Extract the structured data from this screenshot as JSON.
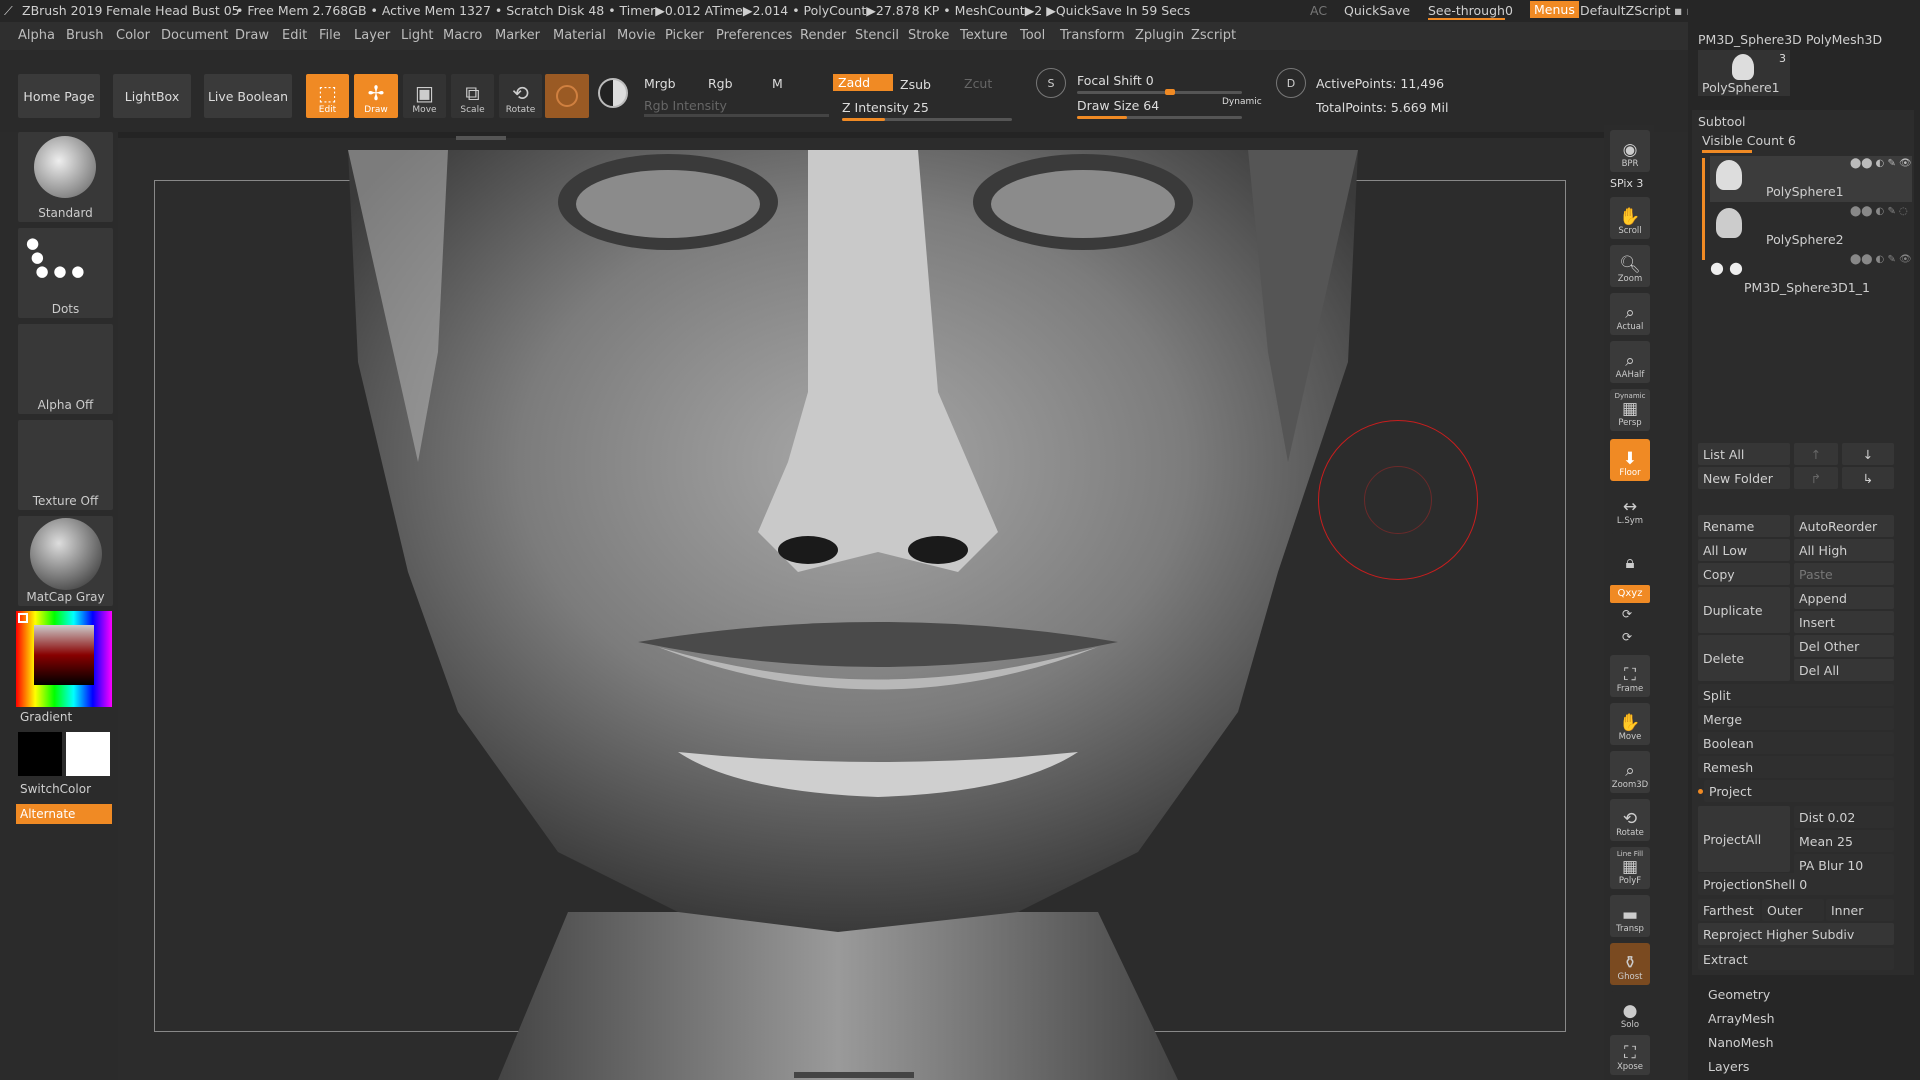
{
  "titlebar": {
    "app": "ZBrush 2019",
    "project": "Female Head Bust 05",
    "stats": "• Free Mem 2.768GB • Active Mem 1327 • Scratch Disk 48 • Timer▶0.012 ATime▶2.014 • PolyCount▶27.878 KP • MeshCount▶2 ▶QuickSave In 59 Secs",
    "ac": "AC",
    "quicksave": "QuickSave",
    "see_through": "See-through",
    "see_through_value": "0",
    "menus": "Menus",
    "zscript": "DefaultZScript"
  },
  "menus": [
    "Alpha",
    "Brush",
    "Color",
    "Document",
    "Draw",
    "Edit",
    "File",
    "Layer",
    "Light",
    "Macro",
    "Marker",
    "Material",
    "Movie",
    "Picker",
    "Preferences",
    "Render",
    "Stencil",
    "Stroke",
    "Texture",
    "Tool",
    "Transform",
    "Zplugin",
    "Zscript"
  ],
  "toolbar": {
    "home_page": "Home Page",
    "lightbox": "LightBox",
    "live_boolean": "Live Boolean",
    "edit": "Edit",
    "draw": "Draw",
    "move": "Move",
    "scale": "Scale",
    "rotate": "Rotate",
    "mrgb": "Mrgb",
    "rgb": "Rgb",
    "m": "M",
    "zadd": "Zadd",
    "zsub": "Zsub",
    "zcut": "Zcut",
    "rgb_intensity": "Rgb Intensity",
    "z_intensity_label": "Z Intensity",
    "z_intensity": "25",
    "z_intensity_fraction": 0.25,
    "focal_shift_label": "Focal Shift",
    "focal_shift": "0",
    "draw_size_label": "Draw Size",
    "draw_size": "64",
    "dynamic": "Dynamic",
    "active_points": "ActivePoints: 11,496",
    "total_points": "TotalPoints: 5.669 Mil",
    "s_label": "S",
    "d_label": "D"
  },
  "left": {
    "standard": "Standard",
    "dots": "Dots",
    "alpha_off": "Alpha Off",
    "texture_off": "Texture Off",
    "matcap": "MatCap Gray",
    "gradient": "Gradient",
    "switchcolor": "SwitchColor",
    "alternate": "Alternate"
  },
  "shelf": [
    "BPR",
    "SPix 3",
    "Scroll",
    "Zoom",
    "Actual",
    "AAHalf",
    "Persp",
    "Floor",
    "L.Sym",
    "",
    "Qxyz",
    "Frame",
    "Move",
    "Zoom3D",
    "Rotate",
    "PolyF",
    "Transp",
    "Ghost",
    "Solo",
    "Xpose"
  ],
  "shelf_extra": {
    "dynamic": "Dynamic",
    "line_fill": "Line Fill"
  },
  "tray": {
    "top_tool_1": "PM3D_Sphere3D",
    "top_tool_2": "PolyMesh3D",
    "top_tool_3": "PolySphere1",
    "top_tool_count": "3",
    "subtool": "Subtool",
    "visible_count": "Visible Count 6",
    "subtools": [
      "PolySphere1",
      "PolySphere2",
      "PM3D_Sphere3D1_1"
    ],
    "list_all": "List All",
    "new_folder": "New Folder",
    "rename": "Rename",
    "autoreorder": "AutoReorder",
    "all_low": "All Low",
    "all_high": "All High",
    "copy": "Copy",
    "paste": "Paste",
    "duplicate": "Duplicate",
    "append": "Append",
    "insert": "Insert",
    "delete": "Delete",
    "del_other": "Del Other",
    "del_all": "Del All",
    "split": "Split",
    "merge": "Merge",
    "boolean": "Boolean",
    "remesh": "Remesh",
    "project": "Project",
    "projectall": "ProjectAll",
    "dist": "Dist 0.02",
    "mean": "Mean 25",
    "pa_blur": "PA Blur 10",
    "projection_shell": "ProjectionShell 0",
    "farthest": "Farthest",
    "outer": "Outer",
    "inner": "Inner",
    "reproject": "Reproject Higher Subdiv",
    "extract": "Extract",
    "geometry": "Geometry",
    "arraymesh": "ArrayMesh",
    "nanomesh": "NanoMesh",
    "layers": "Layers"
  },
  "colors": {
    "accent": "#f08a24",
    "panel": "#2b2b2b",
    "brush_ring": "#c81e1e"
  }
}
